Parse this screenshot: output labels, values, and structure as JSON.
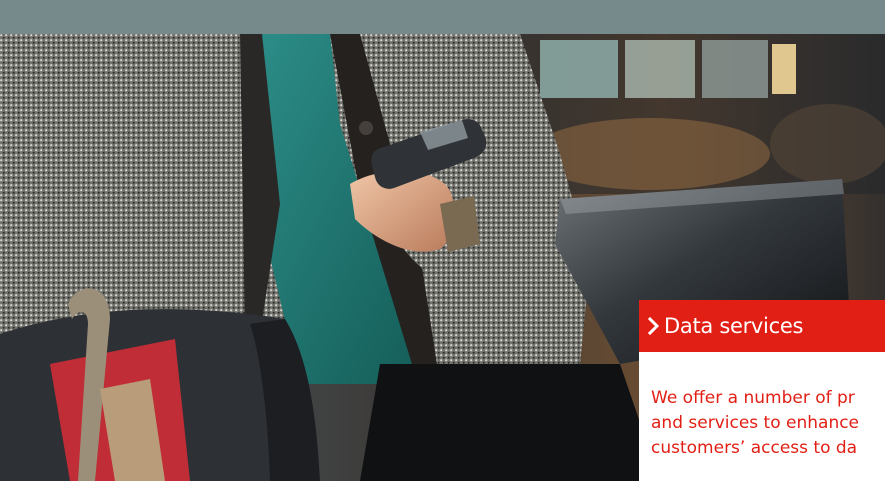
{
  "colors": {
    "top_bar": "#76898b",
    "accent_red": "#e21f14",
    "panel_text_on_red": "#ffffff"
  },
  "photo": {
    "subject": "person-with-phone-and-laptop-photo"
  },
  "panel": {
    "icon": "chevron-right-icon",
    "title": "Data services",
    "body_lines": [
      "We offer a number of pr",
      "and services to enhance",
      "customers’ access to da"
    ]
  }
}
